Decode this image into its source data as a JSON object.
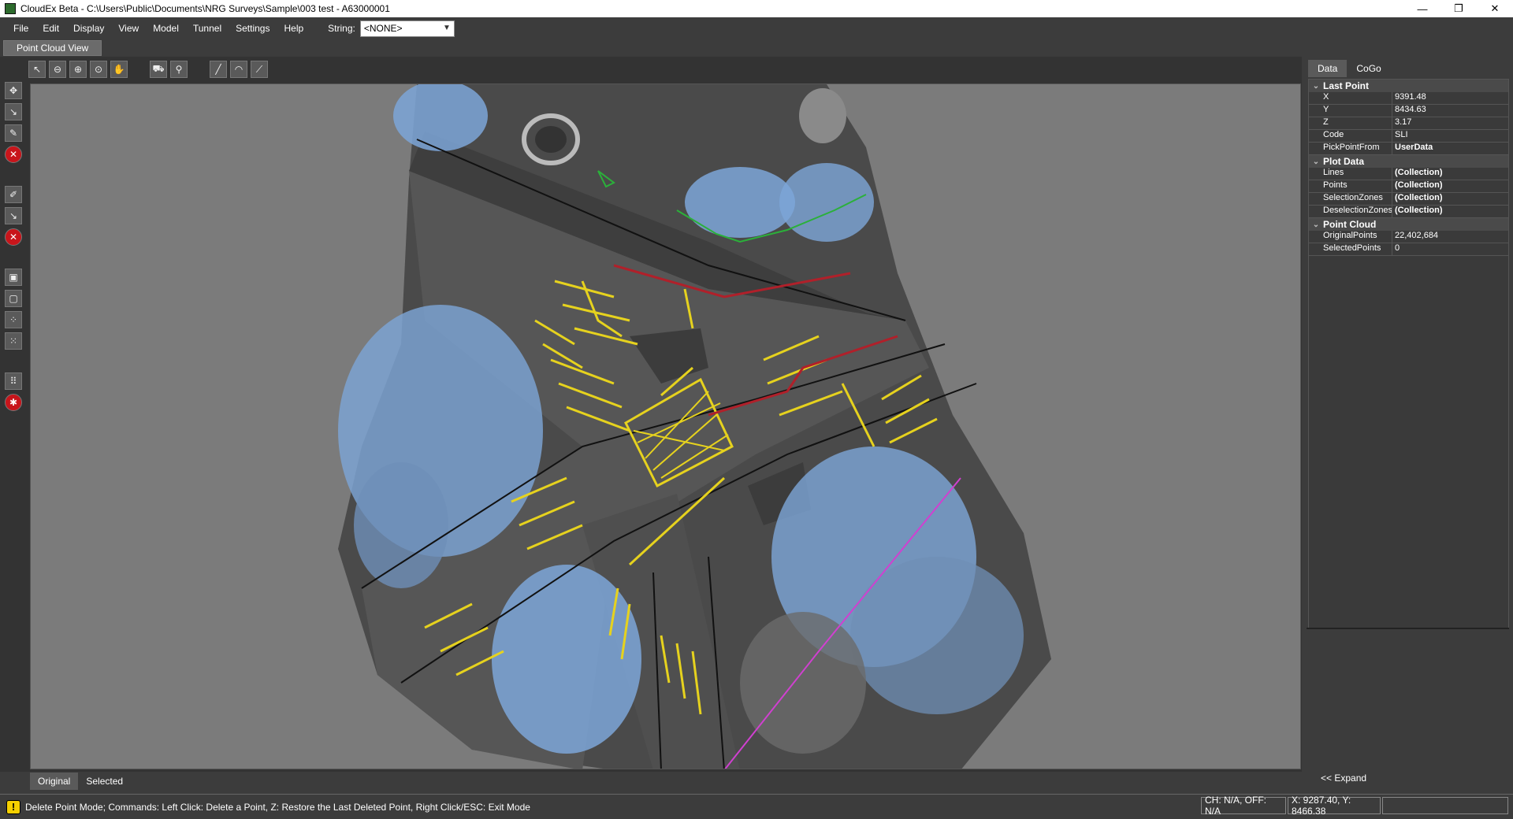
{
  "window": {
    "title": "CloudEx Beta - C:\\Users\\Public\\Documents\\NRG Surveys\\Sample\\003 test - A63000001",
    "min": "—",
    "restore": "❐",
    "close": "✕"
  },
  "menu": {
    "items": [
      "File",
      "Edit",
      "Display",
      "View",
      "Model",
      "Tunnel",
      "Settings",
      "Help"
    ],
    "string_label": "String:",
    "string_value": "<NONE>"
  },
  "doc_tab": "Point Cloud View",
  "bottom_tabs": [
    "Original",
    "Selected"
  ],
  "right_tabs": [
    "Data",
    "CoGo"
  ],
  "properties": {
    "last_point": {
      "title": "Last Point",
      "rows": [
        {
          "name": "X",
          "value": "9391.48"
        },
        {
          "name": "Y",
          "value": "8434.63"
        },
        {
          "name": "Z",
          "value": "3.17"
        },
        {
          "name": "Code",
          "value": "SLI"
        },
        {
          "name": "PickPointFrom",
          "value": "UserData"
        }
      ]
    },
    "plot_data": {
      "title": "Plot Data",
      "rows": [
        {
          "name": "Lines",
          "value": "(Collection)"
        },
        {
          "name": "Points",
          "value": "(Collection)"
        },
        {
          "name": "SelectionZones",
          "value": "(Collection)"
        },
        {
          "name": "DeselectionZones",
          "value": "(Collection)"
        }
      ]
    },
    "point_cloud": {
      "title": "Point Cloud",
      "rows": [
        {
          "name": "OriginalPoints",
          "value": "22,402,684"
        },
        {
          "name": "SelectedPoints",
          "value": "0"
        }
      ]
    }
  },
  "expand_label": "<< Expand",
  "status": {
    "message": "Delete Point Mode; Commands: Left Click: Delete a Point, Z: Restore the Last Deleted Point, Right Click/ESC: Exit Mode",
    "chainage": "CH: N/A, OFF: N/A",
    "coords": "X: 9287.40, Y: 8466.38"
  },
  "colors": {
    "lane_markings": "#e6d21e",
    "breakline_red": "#b0202a",
    "breakline_green": "#2bb03a",
    "line_magenta": "#d040d0",
    "trees": "#7da6d8"
  }
}
